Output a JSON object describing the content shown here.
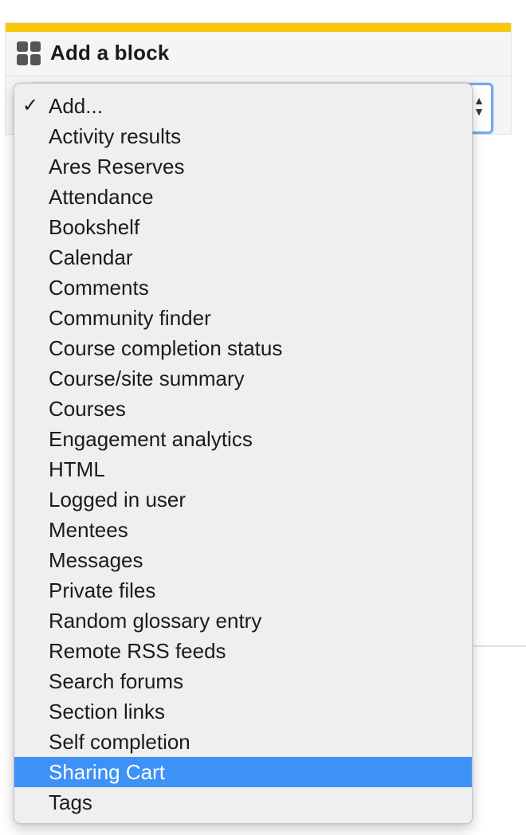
{
  "block": {
    "title": "Add a block",
    "accent_color": "#f9c80e",
    "icon": "grid-icon"
  },
  "select": {
    "selected_value": "Add...",
    "arrows_icon": "updown-arrows-icon"
  },
  "dropdown": {
    "highlight_color": "#3e91f7",
    "check_icon": "checkmark-icon",
    "check_glyph": "✓",
    "options": [
      {
        "label": "Add...",
        "checked": true,
        "highlighted": false
      },
      {
        "label": "Activity results",
        "checked": false,
        "highlighted": false
      },
      {
        "label": "Ares Reserves",
        "checked": false,
        "highlighted": false
      },
      {
        "label": "Attendance",
        "checked": false,
        "highlighted": false
      },
      {
        "label": "Bookshelf",
        "checked": false,
        "highlighted": false
      },
      {
        "label": "Calendar",
        "checked": false,
        "highlighted": false
      },
      {
        "label": "Comments",
        "checked": false,
        "highlighted": false
      },
      {
        "label": "Community finder",
        "checked": false,
        "highlighted": false
      },
      {
        "label": "Course completion status",
        "checked": false,
        "highlighted": false
      },
      {
        "label": "Course/site summary",
        "checked": false,
        "highlighted": false
      },
      {
        "label": "Courses",
        "checked": false,
        "highlighted": false
      },
      {
        "label": "Engagement analytics",
        "checked": false,
        "highlighted": false
      },
      {
        "label": "HTML",
        "checked": false,
        "highlighted": false
      },
      {
        "label": "Logged in user",
        "checked": false,
        "highlighted": false
      },
      {
        "label": "Mentees",
        "checked": false,
        "highlighted": false
      },
      {
        "label": "Messages",
        "checked": false,
        "highlighted": false
      },
      {
        "label": "Private files",
        "checked": false,
        "highlighted": false
      },
      {
        "label": "Random glossary entry",
        "checked": false,
        "highlighted": false
      },
      {
        "label": "Remote RSS feeds",
        "checked": false,
        "highlighted": false
      },
      {
        "label": "Search forums",
        "checked": false,
        "highlighted": false
      },
      {
        "label": "Section links",
        "checked": false,
        "highlighted": false
      },
      {
        "label": "Self completion",
        "checked": false,
        "highlighted": false
      },
      {
        "label": "Sharing Cart",
        "checked": false,
        "highlighted": true
      },
      {
        "label": "Tags",
        "checked": false,
        "highlighted": false
      }
    ]
  }
}
